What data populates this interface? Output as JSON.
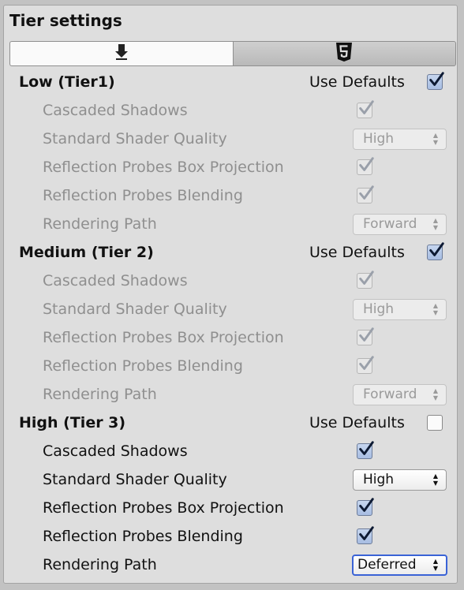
{
  "title": "Tier settings",
  "tabs": [
    {
      "icon": "download-icon",
      "active": true
    },
    {
      "icon": "html5-icon",
      "active": false
    }
  ],
  "use_defaults_label": "Use Defaults",
  "tiers": [
    {
      "name": "Low (Tier1)",
      "use_defaults": true,
      "settings": {
        "cascaded_shadows": {
          "label": "Cascaded Shadows",
          "checked": true
        },
        "shader_quality": {
          "label": "Standard Shader Quality",
          "value": "High"
        },
        "box_projection": {
          "label": "Reflection Probes Box Projection",
          "checked": true
        },
        "blending": {
          "label": "Reflection Probes Blending",
          "checked": true
        },
        "rendering_path": {
          "label": "Rendering Path",
          "value": "Forward"
        }
      }
    },
    {
      "name": "Medium (Tier 2)",
      "use_defaults": true,
      "settings": {
        "cascaded_shadows": {
          "label": "Cascaded Shadows",
          "checked": true
        },
        "shader_quality": {
          "label": "Standard Shader Quality",
          "value": "High"
        },
        "box_projection": {
          "label": "Reflection Probes Box Projection",
          "checked": true
        },
        "blending": {
          "label": "Reflection Probes Blending",
          "checked": true
        },
        "rendering_path": {
          "label": "Rendering Path",
          "value": "Forward"
        }
      }
    },
    {
      "name": "High (Tier 3)",
      "use_defaults": false,
      "settings": {
        "cascaded_shadows": {
          "label": "Cascaded Shadows",
          "checked": true
        },
        "shader_quality": {
          "label": "Standard Shader Quality",
          "value": "High"
        },
        "box_projection": {
          "label": "Reflection Probes Box Projection",
          "checked": true
        },
        "blending": {
          "label": "Reflection Probes Blending",
          "checked": true
        },
        "rendering_path": {
          "label": "Rendering Path",
          "value": "Deferred"
        }
      }
    }
  ],
  "colors": {
    "accent": "#3a63d6",
    "check": "#0d1a33",
    "disabled_text": "#8f8f8f"
  }
}
